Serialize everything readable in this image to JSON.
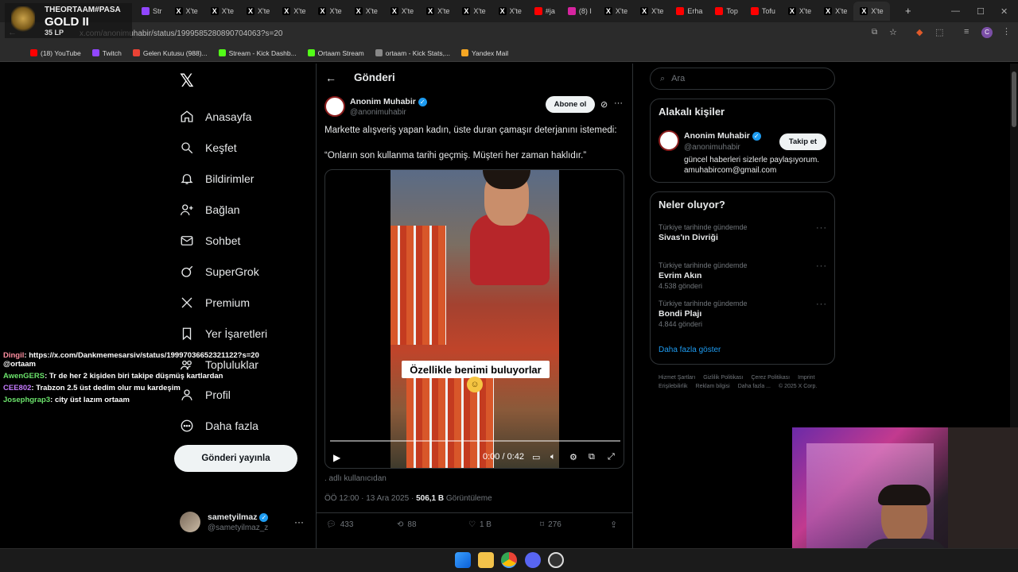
{
  "browser": {
    "tabs": [
      {
        "label": "Str",
        "icon": "twitch-icon",
        "color": "#9146ff"
      },
      {
        "label": "X'te",
        "icon": "x-icon",
        "color": "#000000"
      },
      {
        "label": "X'te",
        "icon": "x-icon",
        "color": "#000000"
      },
      {
        "label": "X'te",
        "icon": "x-icon",
        "color": "#000000"
      },
      {
        "label": "X'te",
        "icon": "x-icon",
        "color": "#000000"
      },
      {
        "label": "X'te",
        "icon": "x-icon",
        "color": "#000000"
      },
      {
        "label": "X'te",
        "icon": "x-icon",
        "color": "#000000"
      },
      {
        "label": "X'te",
        "icon": "x-icon",
        "color": "#000000"
      },
      {
        "label": "X'te",
        "icon": "x-icon",
        "color": "#000000"
      },
      {
        "label": "X'te",
        "icon": "x-icon",
        "color": "#000000"
      },
      {
        "label": "X'te",
        "icon": "x-icon",
        "color": "#000000"
      },
      {
        "label": "#ja",
        "icon": "youtube-icon",
        "color": "#ff0000"
      },
      {
        "label": "(8) I",
        "icon": "instagram-icon",
        "color": "#d6249f"
      },
      {
        "label": "X'te",
        "icon": "x-icon",
        "color": "#000000"
      },
      {
        "label": "X'te",
        "icon": "x-icon",
        "color": "#000000"
      },
      {
        "label": "Erha",
        "icon": "youtube-icon",
        "color": "#ff0000"
      },
      {
        "label": "Top",
        "icon": "youtube-icon",
        "color": "#ff0000"
      },
      {
        "label": "Tofu",
        "icon": "youtube-icon",
        "color": "#ff0000"
      },
      {
        "label": "X'te",
        "icon": "x-icon",
        "color": "#000000"
      },
      {
        "label": "X'te",
        "icon": "x-icon",
        "color": "#000000"
      },
      {
        "label": "X'te",
        "icon": "x-icon",
        "color": "#000000"
      }
    ],
    "url": "x.com/anonimuhabir/status/1999585280890704063?s=20",
    "bookmarks": [
      {
        "label": "(18) YouTube",
        "color": "#ff0000"
      },
      {
        "label": "Twitch",
        "color": "#9146ff"
      },
      {
        "label": "Gelen Kutusu (988)...",
        "color": "#ea4335"
      },
      {
        "label": "Stream - Kick Dashb...",
        "color": "#53fc18"
      },
      {
        "label": "Ortaam Stream",
        "color": "#53fc18"
      },
      {
        "label": "ortaam - Kick Stats,...",
        "color": "#888888"
      },
      {
        "label": "Yandex Mail",
        "color": "#f5a623"
      }
    ]
  },
  "overlay": {
    "player": "THEORTAAM#PASA",
    "rank": "GOLD II",
    "lp": "35 LP",
    "chat": [
      {
        "user": "Dingil",
        "user_color": "#ff8fa0",
        "text": ": https://x.com/Dankmemesarsiv/status/19997036652321122?s=20 @ortaam"
      },
      {
        "user": "AwenGERS",
        "user_color": "#6be36b",
        "text": ": Tr de her 2 kişiden biri takipe düşmüş kartlardan"
      },
      {
        "user": "CEE802",
        "user_color": "#c67bff",
        "text": ": Trabzon 2.5 üst dedim olur mu kardeşim"
      },
      {
        "user": "Josephgrap3",
        "user_color": "#6be36b",
        "text": ": city üst lazım ortaam"
      }
    ]
  },
  "nav": {
    "items": [
      {
        "label": "Anasayfa",
        "icon": "home-icon"
      },
      {
        "label": "Keşfet",
        "icon": "search-icon"
      },
      {
        "label": "Bildirimler",
        "icon": "bell-icon"
      },
      {
        "label": "Bağlan",
        "icon": "add-user-icon"
      },
      {
        "label": "Sohbet",
        "icon": "mail-icon"
      },
      {
        "label": "SuperGrok",
        "icon": "grok-icon"
      },
      {
        "label": "Premium",
        "icon": "x-logo-icon"
      },
      {
        "label": "Yer İşaretleri",
        "icon": "bookmark-icon"
      },
      {
        "label": "Topluluklar",
        "icon": "communities-icon"
      },
      {
        "label": "Profil",
        "icon": "user-icon"
      },
      {
        "label": "Daha fazla",
        "icon": "more-circle-icon"
      }
    ],
    "post_button": "Gönderi yayınla",
    "account_name": "sametyilmaz",
    "account_handle": "@sametyilmaz_z"
  },
  "post": {
    "header": "Gönderi",
    "author": "Anonim Muhabir",
    "handle": "@anonimuhabir",
    "subscribe": "Abone ol",
    "text1": "Markette alışveriş yapan kadın, üste duran çamaşır deterjanını istemedi:",
    "text2": "“Onların son kullanma tarihi geçmiş. Müşteri her zaman haklıdır.”",
    "video_caption": "Özellikle benimi buluyorlar",
    "video_time": "0:00 / 0:42",
    "progress": 0,
    "credit": ". adlı kullanıcıdan",
    "timestamp": "ÖÖ 12:00 · 13 Ara 2025 · ",
    "views": "506,1 B",
    "views_label": " Görüntüleme",
    "stats": {
      "replies": "433",
      "reposts": "88",
      "likes": "1 B",
      "bookmarks": "276"
    }
  },
  "sidebar": {
    "search_placeholder": "Ara",
    "relevant_title": "Alakalı kişiler",
    "person_name": "Anonim Muhabir",
    "person_handle": "@anonimuhabir",
    "follow": "Takip et",
    "bio": "güncel haberleri sizlerle paylaşıyorum. amuhabircom@gmail.com",
    "trending_title": "Neler oluyor?",
    "trends": [
      {
        "context": "Türkiye tarihinde gündemde",
        "title": "Sivas'ın Divriği",
        "count": ""
      },
      {
        "context": "Türkiye tarihinde gündemde",
        "title": "Evrim Akın",
        "count": "4.538 gönderi"
      },
      {
        "context": "Türkiye tarihinde gündemde",
        "title": "Bondi Plajı",
        "count": "4.844 gönderi"
      }
    ],
    "show_more": "Daha fazla göster",
    "footer": [
      "Hizmet Şartları",
      "Gizlilik Politikası",
      "Çerez Politikası",
      "Imprint",
      "Erişilebilirlik",
      "Reklam bilgisi",
      "Daha fazla ...",
      "© 2025 X Corp."
    ]
  },
  "colors": {
    "accent": "#1d9bf0",
    "background": "#000000",
    "border": "#2f3336",
    "muted": "#71767b"
  }
}
